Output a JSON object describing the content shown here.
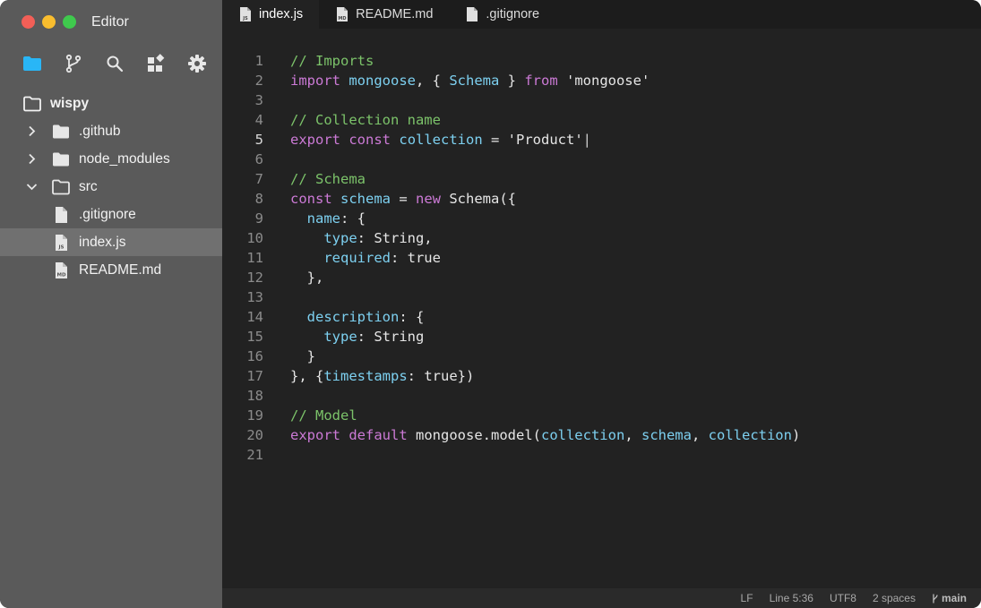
{
  "window": {
    "title": "Editor"
  },
  "colors": {
    "folder_active": "#29b6f6",
    "comment": "#7cc36a",
    "keyword": "#cc7ad6",
    "identifier": "#7dd0f0"
  },
  "activity_bar": [
    {
      "icon": "folder-icon"
    },
    {
      "icon": "git-branch-icon"
    },
    {
      "icon": "search-icon"
    },
    {
      "icon": "extensions-icon"
    },
    {
      "icon": "gear-icon"
    }
  ],
  "explorer": {
    "root": "wispy",
    "items": [
      {
        "label": ".github",
        "type": "folder",
        "state": "collapsed"
      },
      {
        "label": "node_modules",
        "type": "folder",
        "state": "collapsed"
      },
      {
        "label": "src",
        "type": "folder",
        "state": "expanded"
      },
      {
        "label": ".gitignore",
        "type": "file",
        "icon": "file-icon"
      },
      {
        "label": "index.js",
        "type": "file",
        "icon": "js-file-icon",
        "badge": "JS",
        "selected": true
      },
      {
        "label": "README.md",
        "type": "file",
        "icon": "md-file-icon",
        "badge": "MD"
      }
    ]
  },
  "tabs": [
    {
      "label": "index.js",
      "badge": "JS",
      "active": true
    },
    {
      "label": "README.md",
      "badge": "MD",
      "active": false
    },
    {
      "label": ".gitignore",
      "badge": "",
      "active": false
    }
  ],
  "editor": {
    "current_line": 5,
    "lines": [
      [
        [
          "c",
          "// Imports"
        ]
      ],
      [
        [
          "k",
          "import"
        ],
        [
          "p",
          " "
        ],
        [
          "i",
          "mongoose"
        ],
        [
          "p",
          ", { "
        ],
        [
          "i",
          "Schema"
        ],
        [
          "p",
          " } "
        ],
        [
          "k",
          "from"
        ],
        [
          "p",
          " 'mongoose'"
        ]
      ],
      [],
      [
        [
          "c",
          "// Collection name"
        ]
      ],
      [
        [
          "k",
          "export"
        ],
        [
          "p",
          " "
        ],
        [
          "k",
          "const"
        ],
        [
          "p",
          " "
        ],
        [
          "i",
          "collection"
        ],
        [
          "p",
          " = 'Product'"
        ],
        [
          "cur",
          "|"
        ]
      ],
      [],
      [
        [
          "c",
          "// Schema"
        ]
      ],
      [
        [
          "k",
          "const"
        ],
        [
          "p",
          " "
        ],
        [
          "i",
          "schema"
        ],
        [
          "p",
          " = "
        ],
        [
          "k",
          "new"
        ],
        [
          "p",
          " Schema({"
        ]
      ],
      [
        [
          "p",
          "  "
        ],
        [
          "i",
          "name"
        ],
        [
          "p",
          ": {"
        ]
      ],
      [
        [
          "p",
          "    "
        ],
        [
          "i",
          "type"
        ],
        [
          "p",
          ": String,"
        ]
      ],
      [
        [
          "p",
          "    "
        ],
        [
          "i",
          "required"
        ],
        [
          "p",
          ": true"
        ]
      ],
      [
        [
          "p",
          "  },"
        ]
      ],
      [],
      [
        [
          "p",
          "  "
        ],
        [
          "i",
          "description"
        ],
        [
          "p",
          ": {"
        ]
      ],
      [
        [
          "p",
          "    "
        ],
        [
          "i",
          "type"
        ],
        [
          "p",
          ": String"
        ]
      ],
      [
        [
          "p",
          "  }"
        ]
      ],
      [
        [
          "p",
          "}, {"
        ],
        [
          "i",
          "timestamps"
        ],
        [
          "p",
          ": true})"
        ]
      ],
      [],
      [
        [
          "c",
          "// Model"
        ]
      ],
      [
        [
          "k",
          "export"
        ],
        [
          "p",
          " "
        ],
        [
          "k",
          "default"
        ],
        [
          "p",
          " mongoose.model("
        ],
        [
          "i",
          "collection"
        ],
        [
          "p",
          ", "
        ],
        [
          "i",
          "schema"
        ],
        [
          "p",
          ", "
        ],
        [
          "i",
          "collection"
        ],
        [
          "p",
          ")"
        ]
      ],
      []
    ]
  },
  "statusbar": {
    "eol": "LF",
    "position": "Line 5:36",
    "encoding": "UTF8",
    "indent": "2 spaces",
    "branch": "main"
  }
}
